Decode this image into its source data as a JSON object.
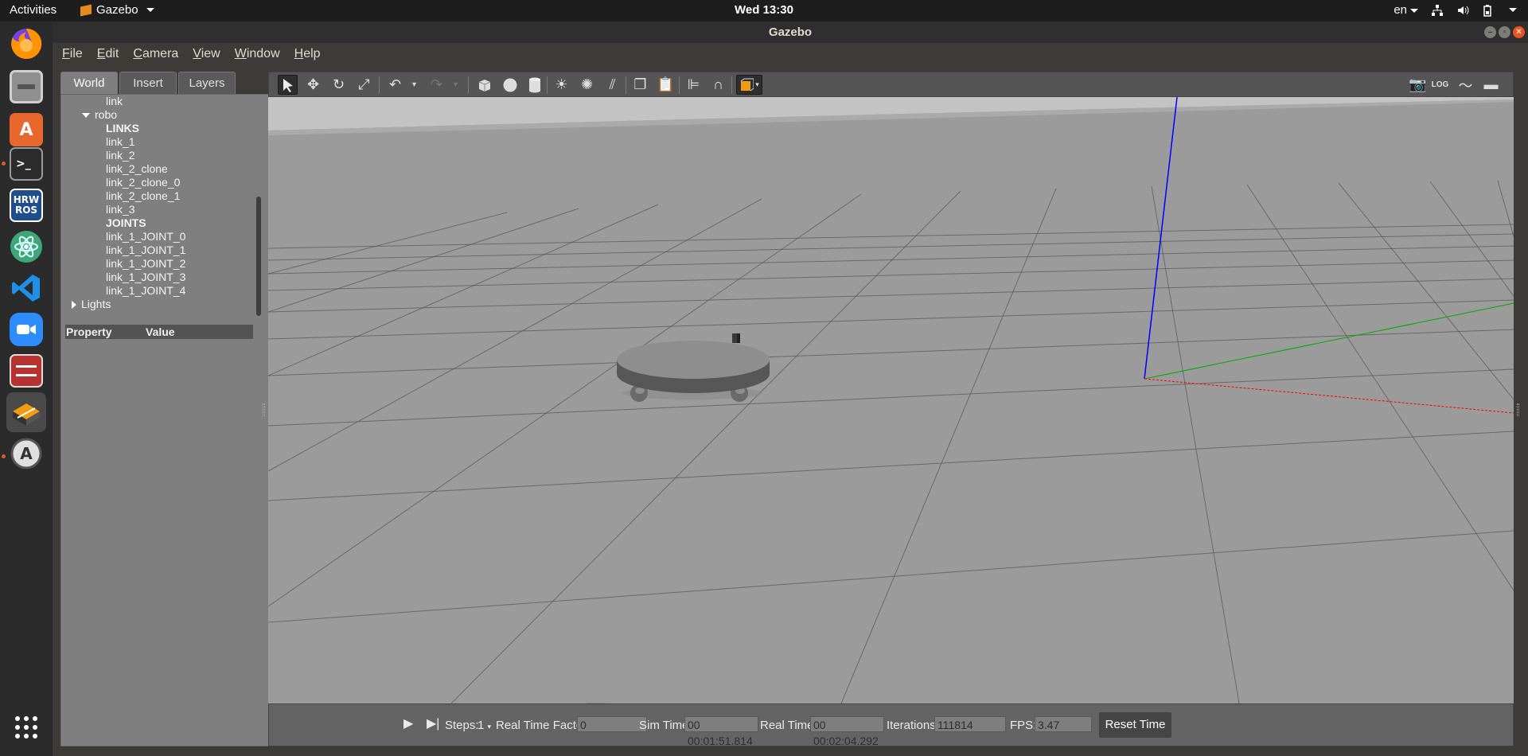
{
  "topbar": {
    "activities": "Activities",
    "app_name": "Gazebo",
    "clock": "Wed 13:30",
    "language": "en",
    "tray_icons": [
      "network-icon",
      "volume-icon",
      "battery-icon"
    ]
  },
  "dock": {
    "items": [
      {
        "name": "firefox",
        "icon": "firefox-icon",
        "running": false
      },
      {
        "name": "files",
        "icon": "files-icon",
        "running": false
      },
      {
        "name": "software",
        "icon": "ubuntu-software-icon",
        "running": false
      },
      {
        "name": "terminal",
        "icon": "terminal-icon",
        "running": true
      },
      {
        "name": "hrw-ros",
        "icon": "hrwros-icon",
        "label": "HRW\nROS",
        "running": false
      },
      {
        "name": "atom",
        "icon": "atom-icon",
        "running": false
      },
      {
        "name": "vscode",
        "icon": "vscode-icon",
        "running": false
      },
      {
        "name": "zoom",
        "icon": "zoom-icon",
        "running": false
      },
      {
        "name": "app",
        "icon": "red-app-icon",
        "running": false
      },
      {
        "name": "gazebo",
        "icon": "gazebo-icon",
        "running": true,
        "active": true
      },
      {
        "name": "updater",
        "icon": "software-updater-icon",
        "running": true
      }
    ],
    "show_apps_icon": "app-grid-icon"
  },
  "window": {
    "title": "Gazebo",
    "menu": [
      "File",
      "Edit",
      "Camera",
      "View",
      "Window",
      "Help"
    ]
  },
  "left_panel": {
    "tabs": [
      "World",
      "Insert",
      "Layers"
    ],
    "selected_tab": "World",
    "tree": [
      {
        "label": "link",
        "indent": 2,
        "bold": false
      },
      {
        "label": "robo",
        "indent": 1,
        "expanded": true
      },
      {
        "label": "LINKS",
        "indent": 2,
        "bold": true
      },
      {
        "label": "link_1",
        "indent": 2
      },
      {
        "label": "link_2",
        "indent": 2
      },
      {
        "label": "link_2_clone",
        "indent": 2
      },
      {
        "label": "link_2_clone_0",
        "indent": 2
      },
      {
        "label": "link_2_clone_1",
        "indent": 2
      },
      {
        "label": "link_3",
        "indent": 2
      },
      {
        "label": "JOINTS",
        "indent": 2,
        "bold": true
      },
      {
        "label": "link_1_JOINT_0",
        "indent": 2
      },
      {
        "label": "link_1_JOINT_1",
        "indent": 2
      },
      {
        "label": "link_1_JOINT_2",
        "indent": 2
      },
      {
        "label": "link_1_JOINT_3",
        "indent": 2
      },
      {
        "label": "link_1_JOINT_4",
        "indent": 2
      },
      {
        "label": "Lights",
        "indent": 0,
        "collapsed": true
      }
    ],
    "property_header": {
      "property": "Property",
      "value": "Value"
    }
  },
  "toolbar": {
    "tools": [
      "select-arrow-icon",
      "translate-icon",
      "rotate-icon",
      "scale-icon",
      "undo-icon",
      "redo-icon",
      "box-icon",
      "sphere-icon",
      "cylinder-icon",
      "point-light-icon",
      "spot-light-icon",
      "directional-light-icon",
      "copy-icon",
      "paste-icon",
      "align-icon",
      "snap-icon",
      "view-angle-icon"
    ],
    "right_tools": [
      "screenshot-icon",
      "log-icon",
      "plot-icon",
      "video-record-icon"
    ],
    "selected_tool": "select-arrow-icon"
  },
  "bottom_bar": {
    "steps_label": "Steps:",
    "steps_value": "1",
    "rtf_label": "Real Time Factor:",
    "rtf_value": "0",
    "sim_time_label": "Sim Time:",
    "sim_time_value": "00 00:01:51.814",
    "real_time_label": "Real Time:",
    "real_time_value": "00 00:02:04.292",
    "iterations_label": "Iterations:",
    "iterations_value": "111814",
    "fps_label": "FPS:",
    "fps_value": "3.47",
    "reset_button": "Reset Time"
  },
  "colors": {
    "topbar_bg": "#1d1d1d",
    "dock_bg": "#2b2b2b",
    "viewport_bg": "#9b9b9b",
    "accent": "#e95420",
    "z_axis": "#0000ff",
    "y_axis": "#00aa00",
    "x_axis": "#ff0000"
  }
}
